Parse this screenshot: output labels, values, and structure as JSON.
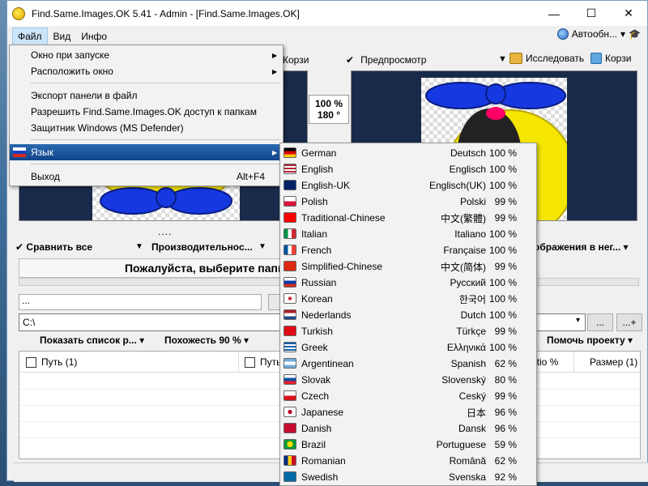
{
  "window": {
    "title": "Find.Same.Images.OK 5.41 - Admin - [Find.Same.Images.OK]",
    "minimize_glyph": "—",
    "maximize_glyph": "☐",
    "close_glyph": "✕"
  },
  "menubar": {
    "file": "Файл",
    "view": "Вид",
    "info": "Инфо",
    "autoupdate": "Автообн..."
  },
  "toolbar": {
    "recycle_left_label": "Корзи",
    "preview_label": "Предпросмотр",
    "explore_label": "Исследовать",
    "recycle_right_label": "Корзи"
  },
  "zoom": {
    "percent": "100 %",
    "angle": "180 °"
  },
  "pane_dots": "....",
  "lower_toolbar": {
    "compare_all": "Сравнить все",
    "performance": "Производительнос...",
    "images_in_neg": "ображения в нег..."
  },
  "message": "Пожалуйста, выберите папк",
  "field_dots": "...",
  "path": {
    "value": "C:\\",
    "browse": "...",
    "browse_add": "...+"
  },
  "list_toolbar": {
    "show_list": "Показать список р...",
    "similarity": "Похожесть 90 %",
    "help_project": "Помочь проекту"
  },
  "list_columns": {
    "path1": "Путь (1)",
    "path2": "Путь (",
    "ratio": "atio %",
    "size": "Размер (1)"
  },
  "file_menu": {
    "items": [
      {
        "label": "Окно при запуске",
        "submenu": true
      },
      {
        "label": "Расположить окно",
        "submenu": true
      },
      {
        "label": "Экспорт панели в файл"
      },
      {
        "label": "Разрешить Find.Same.Images.OK доступ к папкам"
      },
      {
        "label": "Защитник Windows (MS Defender)"
      },
      {
        "label": "Язык",
        "submenu": true
      },
      {
        "label": "Выход",
        "shortcut": "Alt+F4"
      }
    ]
  },
  "languages": [
    {
      "name": "German",
      "native": "Deutsch",
      "percent": "100 %"
    },
    {
      "name": "English",
      "native": "Englisch",
      "percent": "100 %"
    },
    {
      "name": "English-UK",
      "native": "Englisch(UK)",
      "percent": "100 %"
    },
    {
      "name": "Polish",
      "native": "Polski",
      "percent": "99 %"
    },
    {
      "name": "Traditional-Chinese",
      "native": "中文(繁體)",
      "percent": "99 %"
    },
    {
      "name": "Italian",
      "native": "Italiano",
      "percent": "100 %"
    },
    {
      "name": "French",
      "native": "Française",
      "percent": "100 %"
    },
    {
      "name": "Simplified-Chinese",
      "native": "中文(简体)",
      "percent": "99 %"
    },
    {
      "name": "Russian",
      "native": "Русский",
      "percent": "100 %"
    },
    {
      "name": "Korean",
      "native": "한국어",
      "percent": "100 %"
    },
    {
      "name": "Nederlands",
      "native": "Dutch",
      "percent": "100 %"
    },
    {
      "name": "Turkish",
      "native": "Türkçe",
      "percent": "99 %"
    },
    {
      "name": "Greek",
      "native": "Ελληνικά",
      "percent": "100 %"
    },
    {
      "name": "Argentinean",
      "native": "Spanish",
      "percent": "62 %"
    },
    {
      "name": "Slovak",
      "native": "Slovenský",
      "percent": "80 %"
    },
    {
      "name": "Czech",
      "native": "Ceský",
      "percent": "99 %"
    },
    {
      "name": "Japanese",
      "native": "日本",
      "percent": "96 %"
    },
    {
      "name": "Danish",
      "native": "Dansk",
      "percent": "96 %"
    },
    {
      "name": "Brazil",
      "native": "Portuguese",
      "percent": "59 %"
    },
    {
      "name": "Romanian",
      "native": "Română",
      "percent": "62 %"
    },
    {
      "name": "Swedish",
      "native": "Svenska",
      "percent": "92 %"
    }
  ],
  "colors": {
    "menu_highlight": "#1c569c",
    "pane_background": "#1a2a4a",
    "title_background": "#ffffff"
  }
}
